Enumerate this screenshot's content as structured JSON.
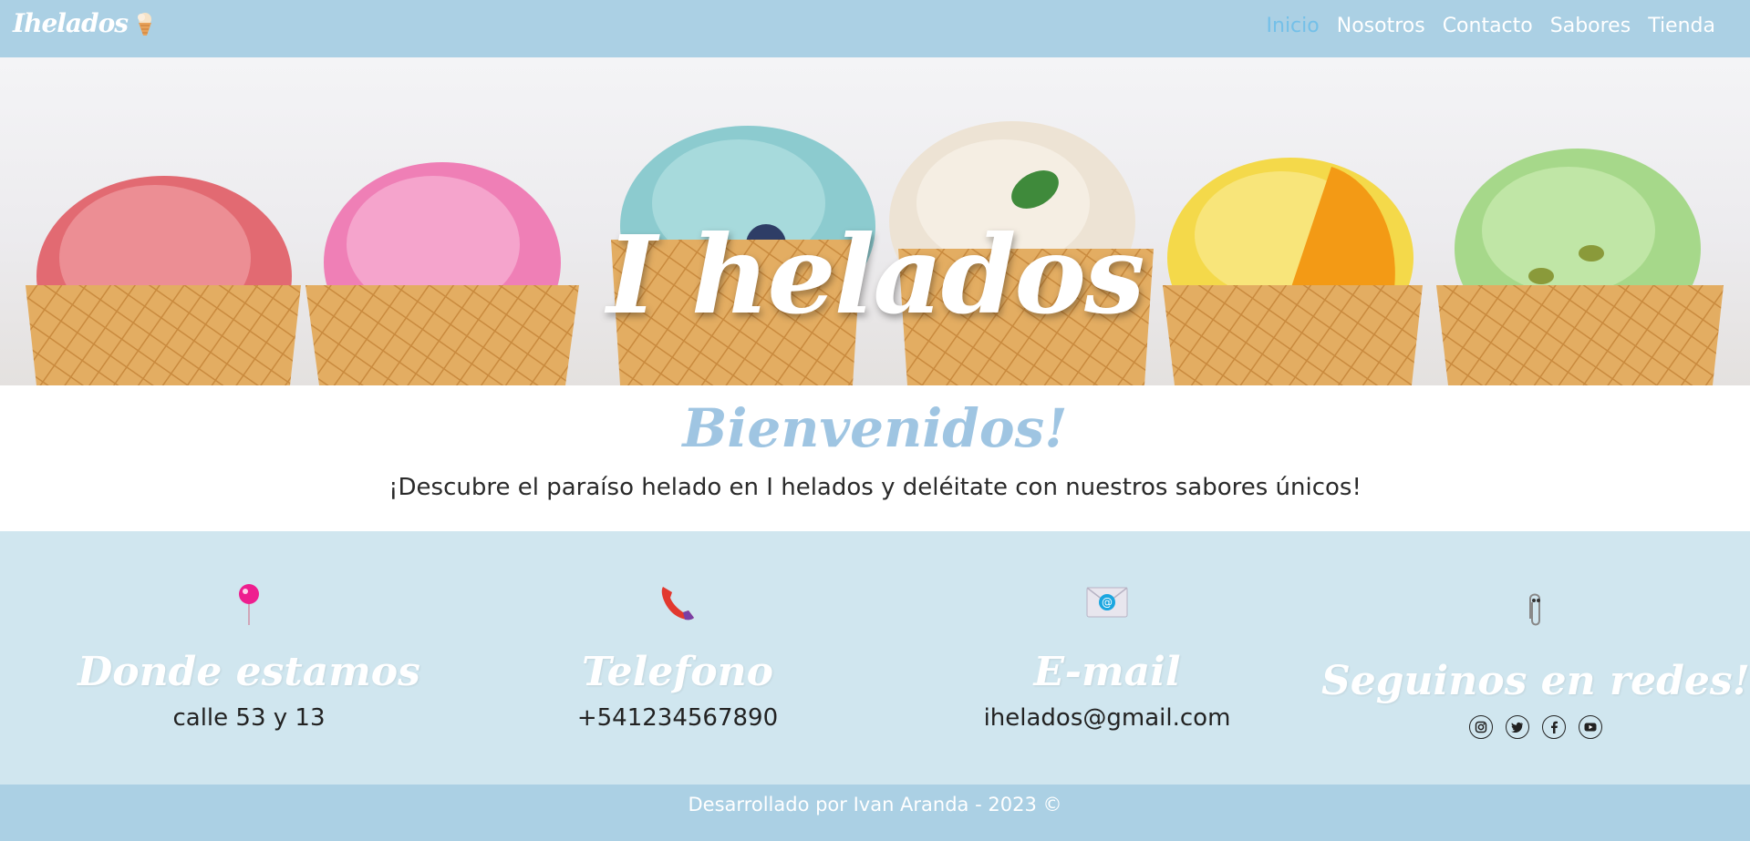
{
  "navbar": {
    "brand": "Ihelados",
    "brand_icon": "ice-cream-icon",
    "links": [
      {
        "label": "Inicio",
        "active": true
      },
      {
        "label": "Nosotros",
        "active": false
      },
      {
        "label": "Contacto",
        "active": false
      },
      {
        "label": "Sabores",
        "active": false
      },
      {
        "label": "Tienda",
        "active": false
      }
    ]
  },
  "hero": {
    "title": "I helados",
    "image": "ice-cream-cones-photo"
  },
  "welcome": {
    "title": "Bienvenidos!",
    "text": "¡Descubre el paraíso helado en I helados y deléitate con nuestros sabores únicos!"
  },
  "info": {
    "location": {
      "icon": "pin-icon",
      "title": "Donde estamos",
      "value": "calle 53 y 13"
    },
    "phone": {
      "icon": "phone-icon",
      "title": "Telefono",
      "value": "+541234567890"
    },
    "email": {
      "icon": "email-icon",
      "title": "E-mail",
      "value": "ihelados@gmail.com"
    },
    "social": {
      "icon": "paperclip-icon",
      "title": "Seguinos en redes!",
      "networks": [
        "instagram-icon",
        "twitter-icon",
        "facebook-icon",
        "youtube-icon"
      ]
    }
  },
  "footer": {
    "text": "Desarrollado por Ivan Aranda - 2023 ©"
  },
  "colors": {
    "navbar": "#abd0e4",
    "nav_active": "#74c0e8",
    "welcome_title": "#9fc5e2",
    "info_bg": "#d0e6ef"
  }
}
